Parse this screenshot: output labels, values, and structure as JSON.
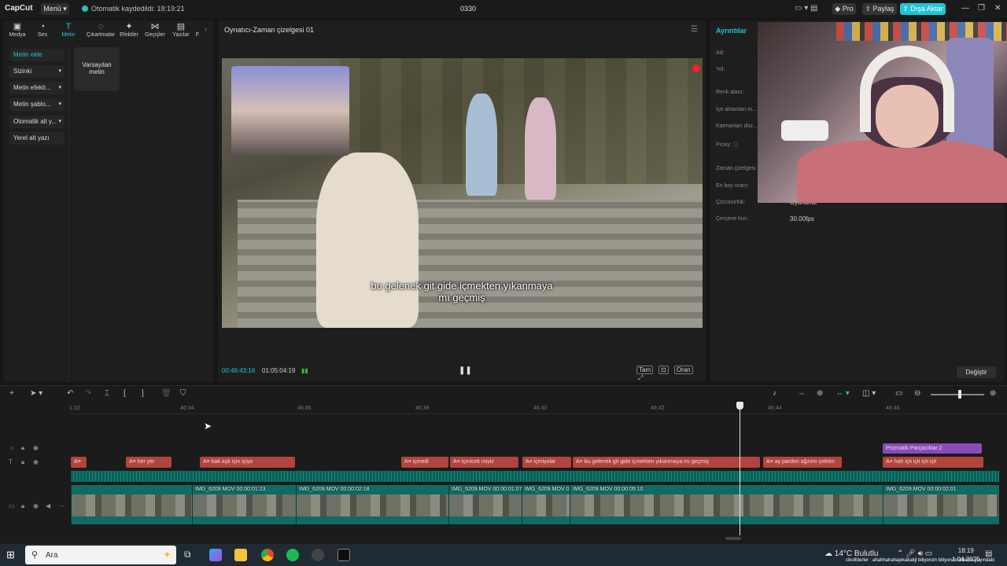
{
  "app": {
    "logo": "CapCut",
    "menu_label": "Menü",
    "autosave": "Otomatik kaydedildi: 18:19:21",
    "project_title": "0330",
    "pro_label": "Pro",
    "share_label": "Paylaş",
    "export_label": "Dışa Aktar",
    "accent_color": "#1fc5d6"
  },
  "toolbar_tabs": [
    {
      "label": "Medya",
      "icon": "media-icon"
    },
    {
      "label": "Ses",
      "icon": "audio-icon"
    },
    {
      "label": "Metin",
      "icon": "text-icon",
      "active": true
    },
    {
      "label": "Çıkartmalar",
      "icon": "sticker-icon"
    },
    {
      "label": "Efektler",
      "icon": "effects-icon"
    },
    {
      "label": "Geçişler",
      "icon": "transitions-icon"
    },
    {
      "label": "Yazılar",
      "icon": "captions-icon"
    },
    {
      "label": "F",
      "icon": "filters-icon"
    }
  ],
  "left_nav": [
    {
      "label": "Metin ekle",
      "active": true
    },
    {
      "label": "Sizinki",
      "has_dropdown": true
    },
    {
      "label": "Metin efekti...",
      "has_dropdown": true
    },
    {
      "label": "Metin şablo...",
      "has_dropdown": true
    },
    {
      "label": "Otomatik alt y...",
      "has_dropdown": true
    },
    {
      "label": "Yerel alt yazı"
    }
  ],
  "default_text_card": "Varsayılan metin",
  "player": {
    "title": "Oynatıcı-Zaman çizelgesi 01",
    "subtitle_line1": "bu gelenek git gide içmekten yıkanmaya",
    "subtitle_line2": "mı geçmiş",
    "time_current": "00:46:43:16",
    "time_total": "01:05:04:19",
    "ctrl_full": "Tam",
    "ctrl_ratio": "Oran"
  },
  "details": {
    "title": "Ayrıntılar",
    "props": [
      {
        "label": "Ad:",
        "value": ""
      },
      {
        "label": "Yol:",
        "value": ""
      },
      {
        "label": "Renk alanı:",
        "value": ""
      },
      {
        "label": "İçe aktarılan m...",
        "value": ""
      },
      {
        "label": "Katmanları düz...",
        "value": ""
      },
      {
        "label": "Proxy: ⓘ",
        "value": ""
      },
      {
        "label": "Zaman çizelgesi...",
        "value": ""
      },
      {
        "label": "En boy oranı:",
        "value": ""
      },
      {
        "label": "Çözünürlük:",
        "value": "Uyarlandı"
      },
      {
        "label": "Çerçeve hızı:",
        "value": "30.00fps"
      }
    ],
    "change_label": "Değiştir"
  },
  "timeline": {
    "ticks": [
      "1:32",
      "46:34",
      "46:36",
      "46:38",
      "46:40",
      "46:42",
      "46:44",
      "46:46"
    ],
    "effect_clip": "Prizmatik Parçacıklar 2",
    "text_clips": [
      {
        "label": "A≡"
      },
      {
        "label": "A≡ her yer"
      },
      {
        "label": "A≡ bak aşk için içiyo"
      },
      {
        "label": "A≡ içmedi"
      },
      {
        "label": "A≡ içmicek miyiz"
      },
      {
        "label": "A≡ içmiyolar"
      },
      {
        "label": "A≡ bu gelenek git gide içmekten yıkanmaya mı geçmiş"
      },
      {
        "label": "A≡ ay pardon ağzımı çektim"
      },
      {
        "label": "A≡ hah içti içti içti içti"
      }
    ],
    "video_clips": [
      {
        "label": ""
      },
      {
        "label": "IMG_6209.MOV   00:00:01:23"
      },
      {
        "label": "IMG_6209.MOV   00:00:02:18"
      },
      {
        "label": "IMG_6209.MOV   00:00:01:07"
      },
      {
        "label": "IMG_6209.MOV   0"
      },
      {
        "label": "IMG_6209.MOV   00:00:05:10"
      },
      {
        "label": "IMG_6209.MOV   00:00:02:01"
      }
    ]
  },
  "taskbar": {
    "search_placeholder": "Ara",
    "weather": "14°C  Bulutlu",
    "clock_time": "18:19",
    "clock_date": "1.04.2025",
    "ticker": "cikolfderler : ahahhahahajekakakjl biliyorum biliyorum izlenim yayındaki"
  }
}
